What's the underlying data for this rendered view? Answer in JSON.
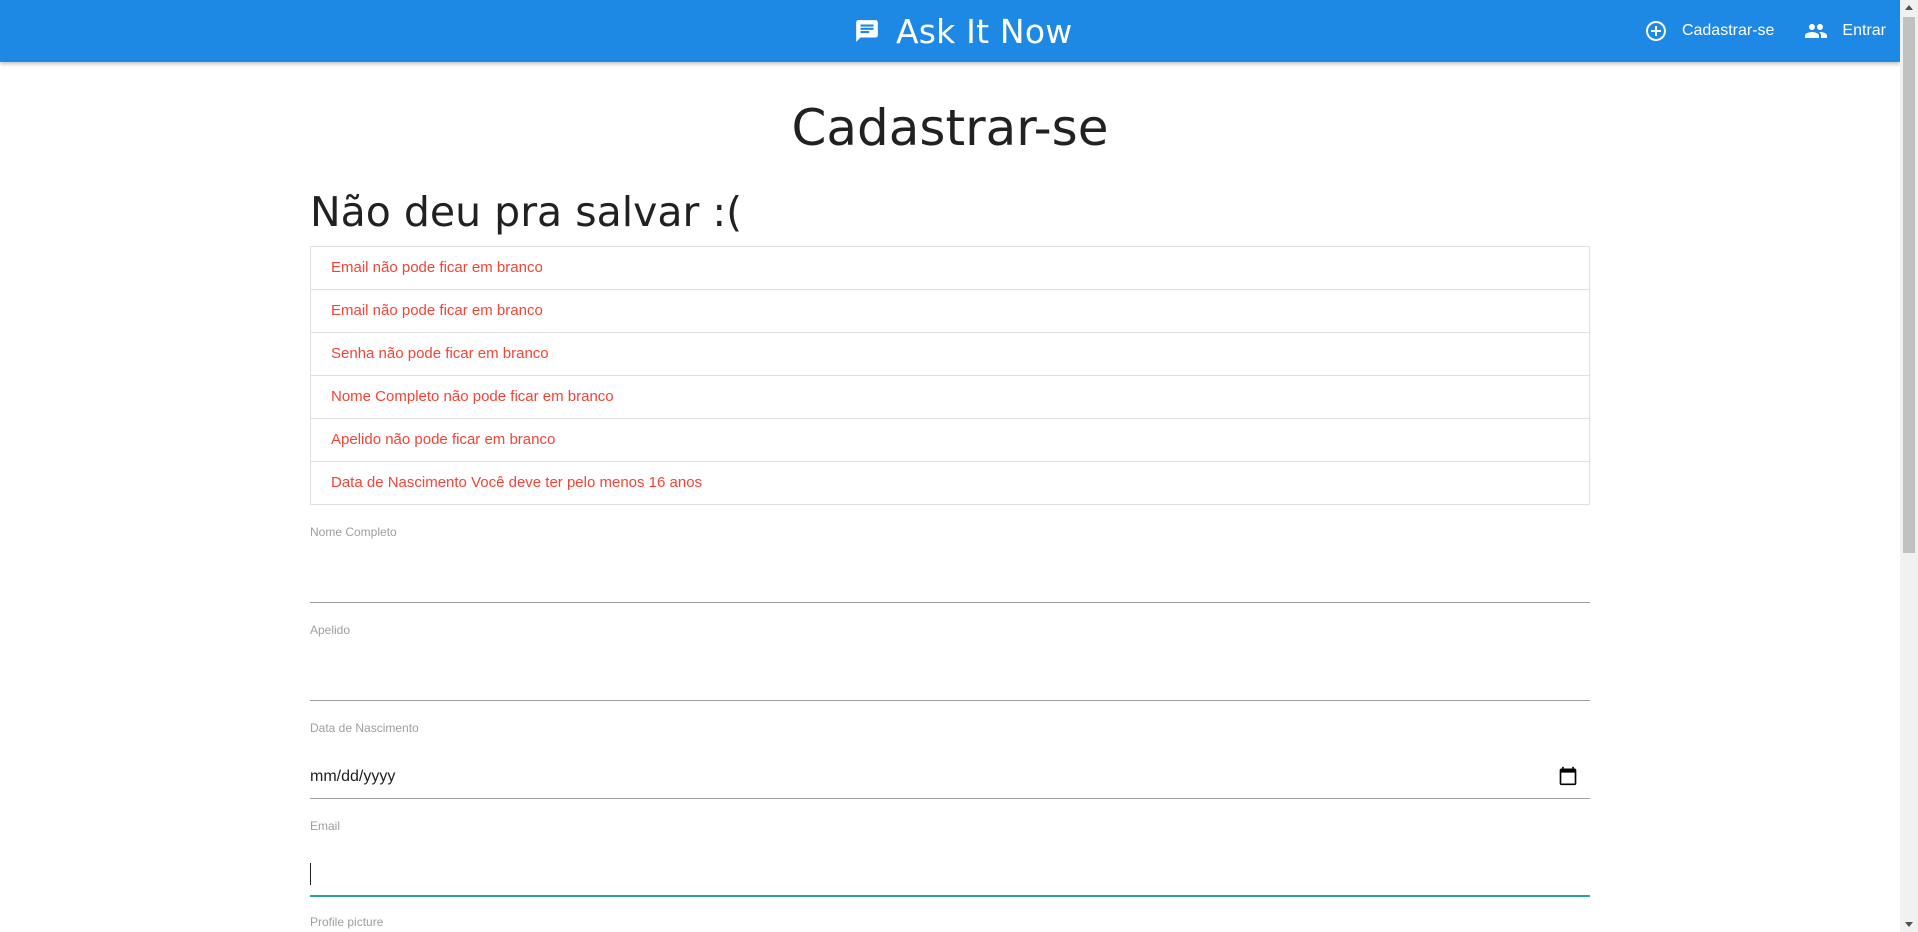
{
  "nav": {
    "brand_icon": "chat-icon",
    "brand_title": "Ask It Now",
    "links": [
      {
        "icon": "add-circle-icon",
        "label": "Cadastrar-se"
      },
      {
        "icon": "people-icon",
        "label": "Entrar"
      }
    ]
  },
  "page": {
    "title": "Cadastrar-se",
    "error_heading": "Não deu pra salvar :(",
    "errors": [
      "Email não pode ficar em branco",
      "Email não pode ficar em branco",
      "Senha não pode ficar em branco",
      "Nome Completo não pode ficar em branco",
      "Apelido não pode ficar em branco",
      "Data de Nascimento Você deve ter pelo menos 16 anos"
    ]
  },
  "form": {
    "full_name": {
      "label": "Nome Completo",
      "value": ""
    },
    "nickname": {
      "label": "Apelido",
      "value": ""
    },
    "birth_date": {
      "label": "Data de Nascimento",
      "placeholder": "mm/dd/yyyy",
      "icon": "calendar-icon"
    },
    "email": {
      "label": "Email",
      "value": ""
    },
    "profile_picture": {
      "label": "Profile picture"
    }
  },
  "colors": {
    "navbar": "#1e88e5",
    "error": "#f44336",
    "focus": "#26a69a"
  }
}
